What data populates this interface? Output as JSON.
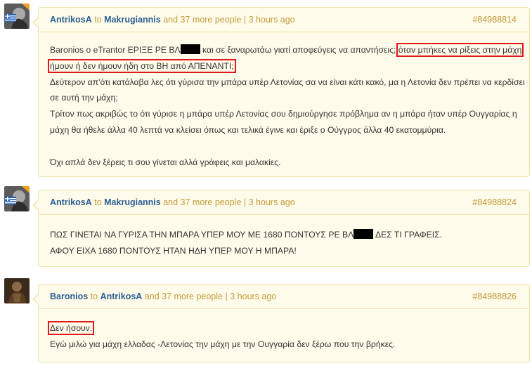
{
  "posts": [
    {
      "author": "AntrikosA",
      "to_word": "to",
      "recipient": "Makrugiannis",
      "extra": "and 37 more people",
      "sep": "|",
      "time": "3 hours ago",
      "post_id": "#84988814",
      "line1_a": "Baronios ο eTrantor ΕΡΙΞΕ ΡΕ ΒΛ",
      "line1_b": " και σε ξαναρωτάω γιατί αποφεύγεις να απαντήσεις;",
      "line1_hl": "όταν μπήκες να ρίξεις στην μάχη",
      "line2_hl": "ήμουν ή δεν ήμουν ήδη στο ΒΗ από ΑΠΕΝΑΝΤΙ;",
      "line3": "Δεύτερον απ'ότι κατάλαβα λες ότι γύρισα την μπάρα υπέρ Λετονίας σα να είναι κάτι κακό, μα η Λετονία δεν πρέπει να κερδίσει",
      "line4": "σε αυτή την μάχη;",
      "line5": "Τρίτον πως ακριβώς το ότι γύρισε η μπάρα υπέρ Λετονίας σου δημιούργησε πρόβλημα αν η μπάρα ήταν υπέρ Ουγγαρίας η",
      "line6": "μάχη θα ήθελε άλλα 40 λεπτά να κλείσει όπως και τελικά έγινε και έριξε ο Ούγγρος άλλα 40 εκατομμύρια.",
      "line8": "Όχι απλά δεν ξέρεις τι σου γίνεται αλλά γράφεις και μαλακίες."
    },
    {
      "author": "AntrikosA",
      "to_word": "to",
      "recipient": "Makrugiannis",
      "extra": "and 37 more people",
      "sep": "|",
      "time": "3 hours ago",
      "post_id": "#84988824",
      "line1_a": "ΠΩΣ ΓΙΝΕΤΑΙ ΝΑ ΓΥΡΙΣΑ ΤΗΝ ΜΠΑΡΑ ΥΠΕΡ ΜΟΥ ΜΕ 1680 ΠΟΝΤΟΥΣ ΡΕ ΒΛ",
      "line1_b": " ΔΕΣ ΤΙ ΓΡΑΦΕΙΣ.",
      "line2": "ΑΦΟΥ ΕΙΧΑ 1680 ΠΟΝΤΟΥΣ ΗΤΑΝ ΗΔΗ ΥΠΕΡ ΜΟΥ Η ΜΠΑΡΑ!"
    },
    {
      "author": "Baronios",
      "to_word": "to",
      "recipient": "AntrikosA",
      "extra": "and 37 more people",
      "sep": "|",
      "time": "3 hours ago",
      "post_id": "#84988826",
      "line1_hl": "Δεν ήσουν.",
      "line2": "Εγώ μιλώ για μάχη ελλαδας -Λετονίας την μάχη με την Ουγγαρία δεν ξέρω που την βρήκες."
    }
  ]
}
